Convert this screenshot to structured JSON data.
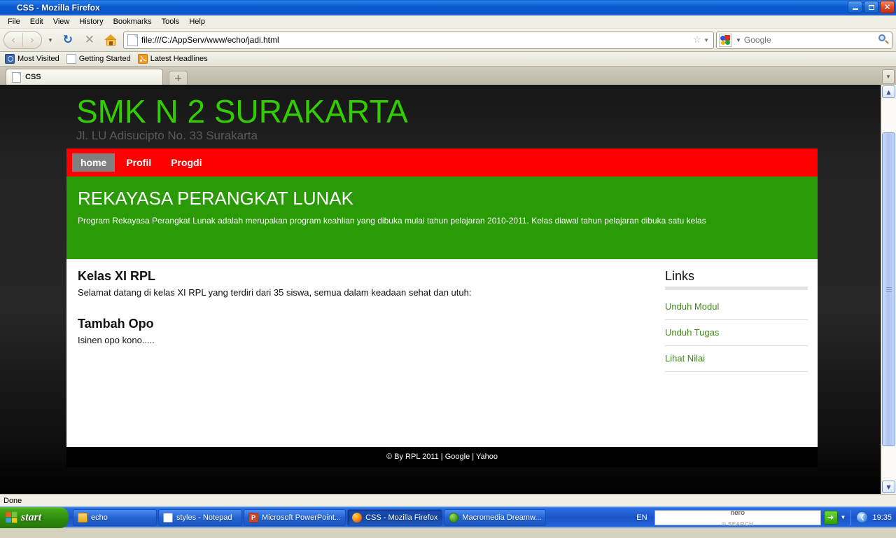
{
  "window": {
    "title": "CSS - Mozilla Firefox",
    "app_icon": "firefox-icon",
    "minimize_label": "Minimize",
    "restore_label": "Restore",
    "close_label": "✕"
  },
  "menubar": {
    "items": [
      "File",
      "Edit",
      "View",
      "History",
      "Bookmarks",
      "Tools",
      "Help"
    ]
  },
  "toolbar": {
    "back_glyph": "‹",
    "forward_glyph": "›",
    "dropdown_glyph": "▼",
    "reload_glyph": "↻",
    "stop_glyph": "✕",
    "home_label": "Home",
    "url": "file:///C:/AppServ/www/echo/jadi.html",
    "star_glyph": "☆",
    "url_caret": "▼"
  },
  "search": {
    "engine": "Google",
    "placeholder": "Google",
    "value": "",
    "engine_caret": "▼",
    "magnifier": "search-icon"
  },
  "bookmarks": {
    "items": [
      {
        "label": "Most Visited",
        "icon": "most-visited-icon"
      },
      {
        "label": "Getting Started",
        "icon": "page-icon"
      },
      {
        "label": "Latest Headlines",
        "icon": "rss-icon"
      }
    ]
  },
  "tabs": {
    "items": [
      {
        "label": "CSS",
        "icon": "page-icon",
        "active": true
      }
    ],
    "new_tab_glyph": "+",
    "list_all_glyph": "▼"
  },
  "page": {
    "site_title": "SMK N 2 SURAKARTA",
    "site_subtitle": "Jl. LU Adisucipto No. 33 Surakarta",
    "nav": [
      {
        "label": "home",
        "active": true
      },
      {
        "label": "Profil",
        "active": false
      },
      {
        "label": "Progdi",
        "active": false
      }
    ],
    "banner": {
      "heading": "REKAYASA PERANGKAT LUNAK",
      "text": "Program Rekayasa Perangkat Lunak adalah merupakan program keahlian yang dibuka mulai tahun pelajaran 2010-2011. Kelas diawal tahun pelajaran dibuka satu kelas"
    },
    "articles": [
      {
        "heading": "Kelas XI RPL",
        "text": "Selamat datang di kelas XI RPL yang terdiri dari 35 siswa, semua dalam keadaan sehat dan utuh:"
      },
      {
        "heading": "Tambah Opo",
        "text": "Isinen opo kono....."
      }
    ],
    "sidebar": {
      "heading": "Links",
      "links": [
        "Unduh Modul",
        "Unduh Tugas",
        "Lihat Nilai"
      ]
    },
    "footer": {
      "copyright": "© By RPL 2011 | ",
      "link1": "Google",
      "separator": " | ",
      "link2": "Yahoo"
    },
    "colors": {
      "title_green": "#33cc00",
      "nav_red": "#ff0000",
      "banner_green": "#2a9a07",
      "link_green": "#3c8c14",
      "active_nav_gray": "#808080",
      "page_background": "#1f1f1f"
    }
  },
  "scrollbar": {
    "up_glyph": "▲",
    "down_glyph": "▼"
  },
  "status": {
    "text": "Done"
  },
  "taskbar": {
    "start_label": "start",
    "tasks": [
      {
        "label": "echo",
        "icon": "folder-icon",
        "active": false
      },
      {
        "label": "styles - Notepad",
        "icon": "notepad-icon",
        "active": false
      },
      {
        "label": "Microsoft PowerPoint...",
        "icon": "powerpoint-icon",
        "active": false
      },
      {
        "label": "CSS - Mozilla Firefox",
        "icon": "firefox-icon",
        "active": true
      },
      {
        "label": "Macromedia Dreamw...",
        "icon": "dreamweaver-icon",
        "active": false
      }
    ],
    "language": "EN",
    "nero_top": "nero",
    "nero_bottom": "® SEARCH",
    "go_glyph": "➜",
    "tray_caret": "▼",
    "clock_icon_glyph": "❮",
    "clock": "19:35"
  }
}
